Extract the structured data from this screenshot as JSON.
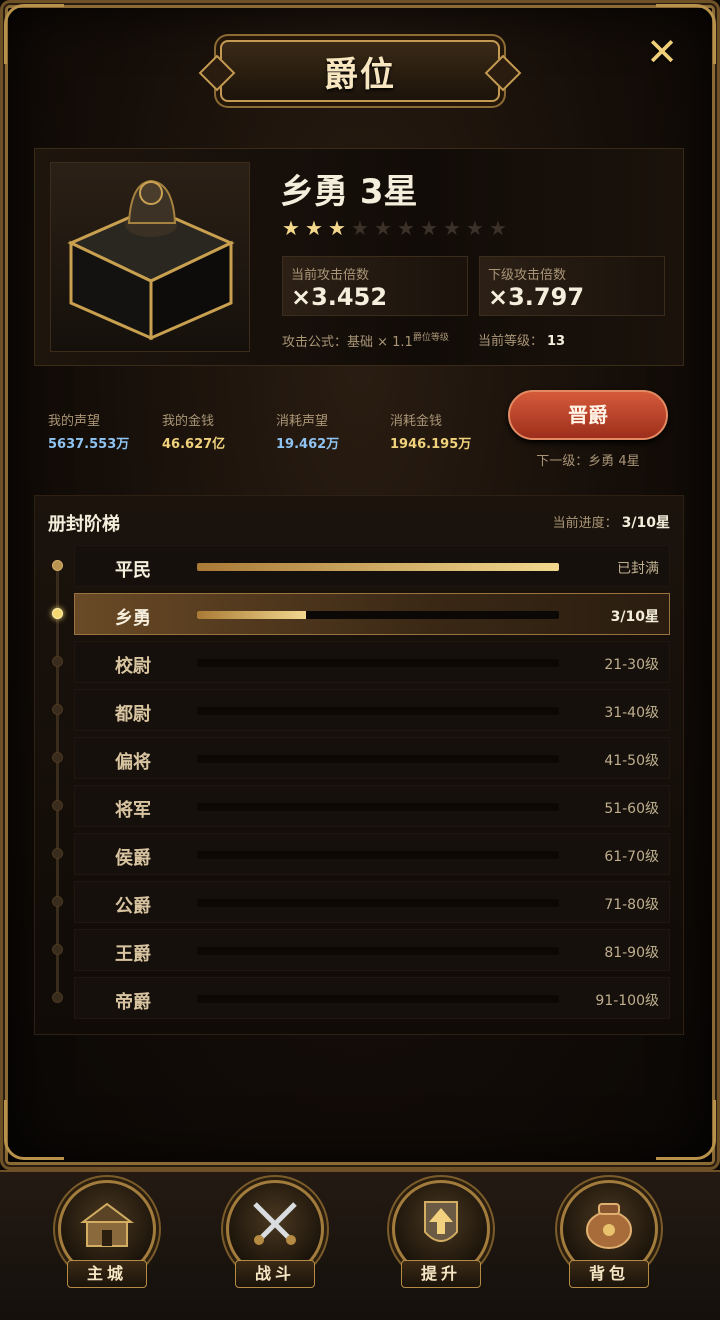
{
  "header": {
    "title": "爵位",
    "close_icon": "close-icon"
  },
  "rank": {
    "name": "乡勇 3星",
    "stars_total": 10,
    "stars_filled": 3,
    "current_attack_label": "当前攻击倍数",
    "current_attack_value": "×3.452",
    "next_attack_label": "下级攻击倍数",
    "next_attack_value": "×3.797",
    "formula_prefix": "攻击公式：基础 × 1.1",
    "formula_sup": "爵位等级",
    "current_level_label": "当前等级：",
    "current_level_value": "13"
  },
  "resources": [
    {
      "label": "我的声望",
      "value": "5637.553万",
      "color": "blue"
    },
    {
      "label": "我的金钱",
      "value": "46.627亿",
      "color": "gold"
    },
    {
      "label": "消耗声望",
      "value": "19.462万",
      "color": "blue"
    },
    {
      "label": "消耗金钱",
      "value": "1946.195万",
      "color": "gold"
    }
  ],
  "promote": {
    "label": "晋爵",
    "next_text": "下一级：乡勇 4星"
  },
  "ladder": {
    "title": "册封阶梯",
    "progress_label": "当前进度：",
    "progress_value": "3/10星",
    "tiers": [
      {
        "name": "平民",
        "tag": "已封满",
        "state": "done",
        "progress": 1.0
      },
      {
        "name": "乡勇",
        "tag": "3/10星",
        "state": "active",
        "progress": 0.3
      },
      {
        "name": "校尉",
        "tag": "21-30级",
        "state": "locked",
        "progress": 0
      },
      {
        "name": "都尉",
        "tag": "31-40级",
        "state": "locked",
        "progress": 0
      },
      {
        "name": "偏将",
        "tag": "41-50级",
        "state": "locked",
        "progress": 0
      },
      {
        "name": "将军",
        "tag": "51-60级",
        "state": "locked",
        "progress": 0
      },
      {
        "name": "侯爵",
        "tag": "61-70级",
        "state": "locked",
        "progress": 0
      },
      {
        "name": "公爵",
        "tag": "71-80级",
        "state": "locked",
        "progress": 0
      },
      {
        "name": "王爵",
        "tag": "81-90级",
        "state": "locked",
        "progress": 0
      },
      {
        "name": "帝爵",
        "tag": "91-100级",
        "state": "locked",
        "progress": 0
      }
    ]
  },
  "nav": [
    {
      "label": "主城",
      "icon": "city-icon"
    },
    {
      "label": "战斗",
      "icon": "swords-icon"
    },
    {
      "label": "提升",
      "icon": "upgrade-icon"
    },
    {
      "label": "背包",
      "icon": "bag-icon"
    }
  ]
}
